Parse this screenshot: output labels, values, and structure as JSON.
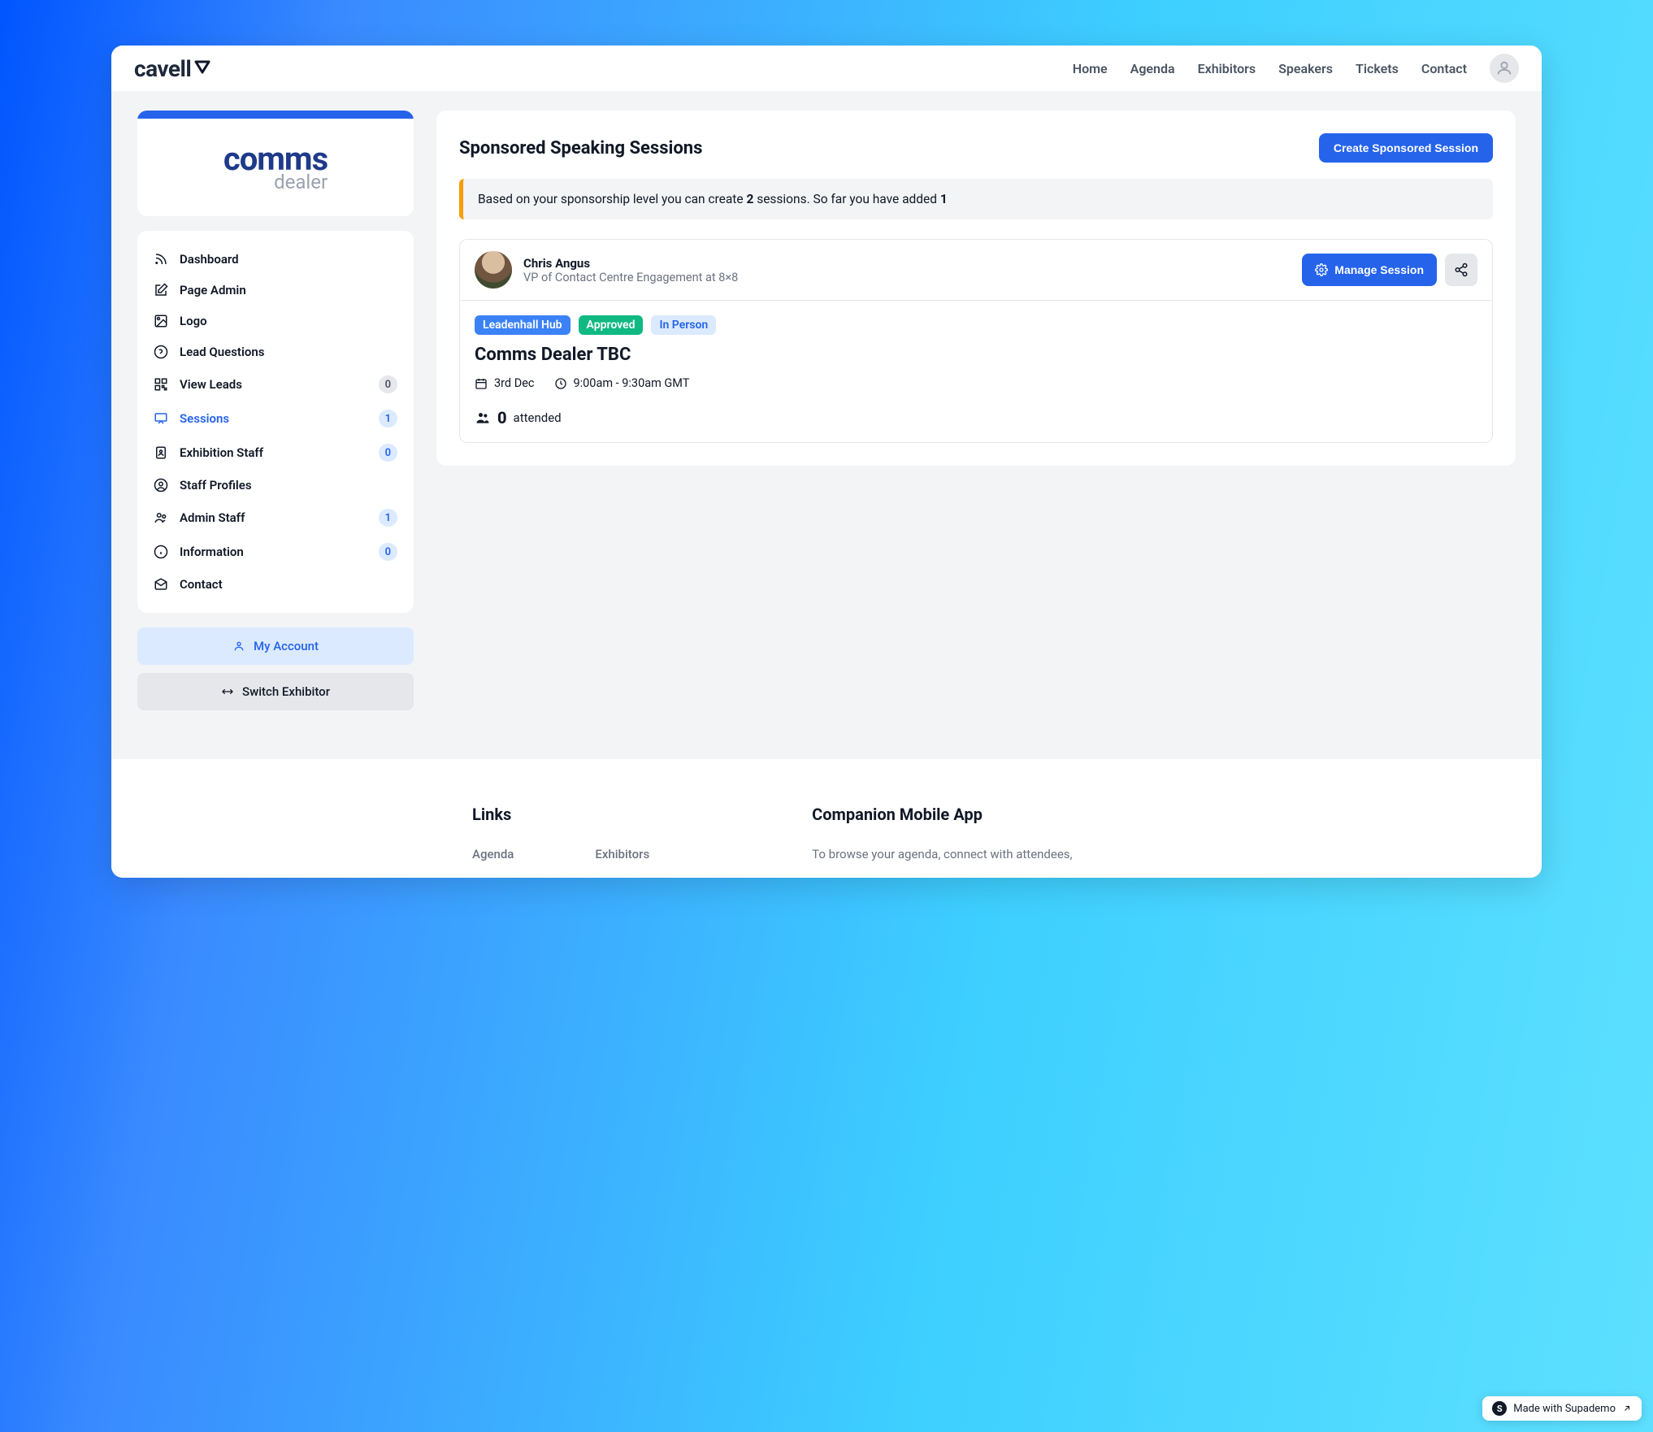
{
  "brand": {
    "name": "cavell"
  },
  "top_nav": {
    "home": "Home",
    "agenda": "Agenda",
    "exhibitors": "Exhibitors",
    "speakers": "Speakers",
    "tickets": "Tickets",
    "contact": "Contact"
  },
  "company": {
    "name_main": "comms",
    "name_sub": "dealer"
  },
  "sidebar": {
    "dashboard": "Dashboard",
    "page_admin": "Page Admin",
    "logo": "Logo",
    "lead_questions": "Lead Questions",
    "view_leads": "View Leads",
    "view_leads_count": "0",
    "sessions": "Sessions",
    "sessions_count": "1",
    "exhibition_staff": "Exhibition Staff",
    "exhibition_staff_count": "0",
    "staff_profiles": "Staff Profiles",
    "admin_staff": "Admin Staff",
    "admin_staff_count": "1",
    "information": "Information",
    "information_count": "0",
    "contact": "Contact",
    "my_account": "My Account",
    "switch_exhibitor": "Switch Exhibitor"
  },
  "main": {
    "title": "Sponsored Speaking Sessions",
    "create_button": "Create Sponsored Session",
    "alert_prefix": "Based on your sponsorship level you can create ",
    "alert_max": "2",
    "alert_mid": " sessions. So far you have added ",
    "alert_count": "1",
    "speaker": {
      "name": "Chris Angus",
      "title": "VP of Contact Centre Engagement at 8×8"
    },
    "manage_button": "Manage Session",
    "chips": {
      "location": "Leadenhall Hub",
      "status": "Approved",
      "mode": "In Person"
    },
    "session_title": "Comms Dealer TBC",
    "date": "3rd Dec",
    "time": "9:00am - 9:30am GMT",
    "attended_count": "0",
    "attended_label": "attended"
  },
  "footer": {
    "links_heading": "Links",
    "link_agenda": "Agenda",
    "link_exhibitors": "Exhibitors",
    "app_heading": "Companion Mobile App",
    "app_desc": "To browse your agenda, connect with attendees,"
  },
  "supademo": "Made with Supademo"
}
